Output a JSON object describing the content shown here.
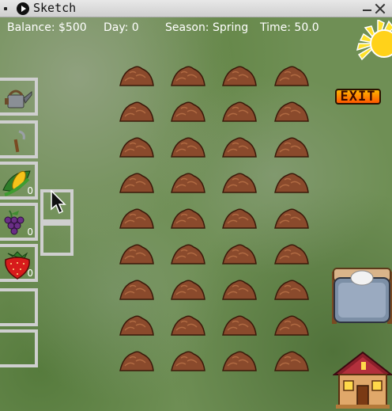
{
  "window": {
    "title": "Sketch"
  },
  "hud": {
    "balance": "Balance: $500",
    "day": "Day: 0",
    "season": "Season: Spring",
    "time": "Time: 50.0"
  },
  "exit_label": "EXIT",
  "inventory": [
    {
      "item": "watering-can-icon",
      "count": ""
    },
    {
      "item": "sickle-icon",
      "count": ""
    },
    {
      "item": "corn-icon",
      "count": "0"
    },
    {
      "item": "grapes-icon",
      "count": "0"
    },
    {
      "item": "strawberry-icon",
      "count": "0"
    },
    {
      "item": "",
      "count": ""
    },
    {
      "item": "",
      "count": ""
    }
  ],
  "farm": {
    "rows": 9,
    "cols": 4
  },
  "colors": {
    "soil": "#8a4a2c",
    "grass": "#6f8f55",
    "exit_button": "#ff8a00",
    "slot_border": "#cfcfcf"
  }
}
